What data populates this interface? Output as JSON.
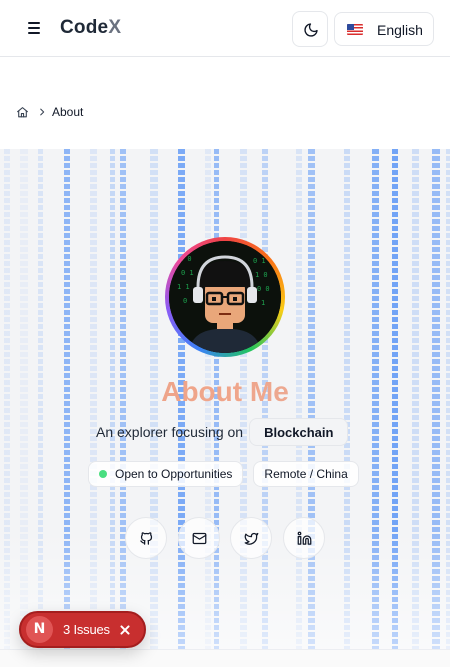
{
  "header": {
    "brand": "CodeX",
    "brand_main": "Code",
    "brand_accent": "X",
    "menu_icon": "hamburger-icon",
    "theme_icon": "moon-icon",
    "language": {
      "flag": "us-flag-icon",
      "label": "English"
    }
  },
  "breadcrumb": {
    "home_icon": "home-icon",
    "separator_icon": "chevron-right-icon",
    "current": "About"
  },
  "hero": {
    "title": "About Me",
    "subtitle": "An explorer focusing on",
    "focus": "Blockchain",
    "badges": [
      {
        "label": "Open to Opportunities",
        "status_color": "#4ade80"
      },
      {
        "label": "Remote / China"
      }
    ],
    "socials": [
      {
        "name": "github-icon"
      },
      {
        "name": "mail-icon"
      },
      {
        "name": "twitter-icon"
      },
      {
        "name": "linkedin-icon"
      }
    ],
    "colors": {
      "rain": "#3b82f6",
      "title_gradient": [
        "#e9a38a",
        "#e4b0a0"
      ]
    }
  },
  "issues_toast": {
    "initial": "N",
    "label": "3 Issues",
    "color": "#c82f2f"
  }
}
